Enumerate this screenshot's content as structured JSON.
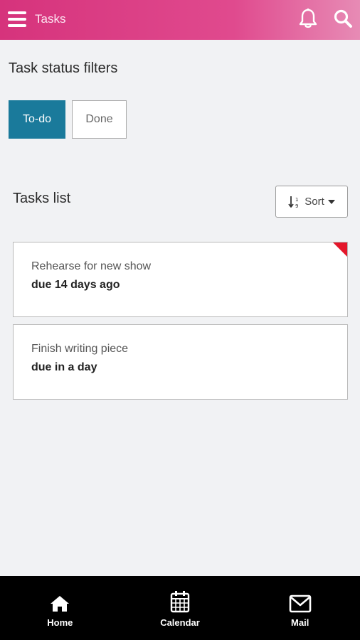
{
  "header": {
    "title": "Tasks",
    "menu_icon": "hamburger-menu-icon",
    "notifications_icon": "bell-icon",
    "search_icon": "search-icon",
    "gradient_start": "#d6337c",
    "gradient_end": "#e78bb5"
  },
  "filters": {
    "title": "Task status filters",
    "todo_label": "To-do",
    "done_label": "Done",
    "active": "To-do",
    "active_color": "#1a7a9b"
  },
  "tasks": {
    "title": "Tasks list",
    "sort_label": "Sort",
    "sort_icon": "sort-numeric-icon",
    "items": [
      {
        "name": "Rehearse for new show",
        "due": "due 14 days ago",
        "overdue": true,
        "flag_color": "#e4162a"
      },
      {
        "name": "Finish writing piece",
        "due": "due in a day",
        "overdue": false
      }
    ]
  },
  "bottom_nav": {
    "items": [
      {
        "label": "Home",
        "icon": "home-icon"
      },
      {
        "label": "Calendar",
        "icon": "calendar-icon"
      },
      {
        "label": "Mail",
        "icon": "mail-icon"
      }
    ]
  }
}
